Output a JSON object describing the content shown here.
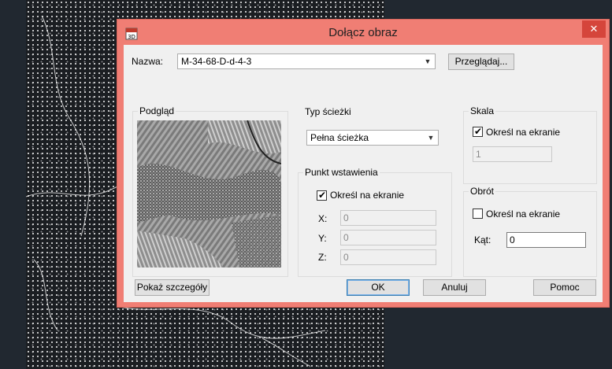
{
  "dialog": {
    "title": "Dołącz obraz",
    "close_glyph": "✕",
    "app_icon": "attach-image-app-icon"
  },
  "name_row": {
    "label": "Nazwa:",
    "value": "M-34-68-D-d-4-3",
    "browse_label": "Przeglądaj..."
  },
  "preview": {
    "caption": "Podgląd"
  },
  "path_type": {
    "caption": "Typ ścieżki",
    "value": "Pełna ścieżka"
  },
  "insertion_point": {
    "caption": "Punkt wstawienia",
    "specify_label": "Określ na ekranie",
    "specify_checked": true,
    "x_label": "X:",
    "x_value": "0",
    "y_label": "Y:",
    "y_value": "0",
    "z_label": "Z:",
    "z_value": "0"
  },
  "scale": {
    "caption": "Skala",
    "specify_label": "Określ na ekranie",
    "specify_checked": true,
    "value": "1"
  },
  "rotation": {
    "caption": "Obrót",
    "specify_label": "Określ na ekranie",
    "specify_checked": false,
    "angle_label": "Kąt:",
    "angle_value": "0"
  },
  "buttons": {
    "details": "Pokaż szczegóły",
    "ok": "OK",
    "cancel": "Anuluj",
    "help": "Pomoc"
  },
  "colors": {
    "dialog_frame": "#f07e74",
    "close_button": "#d5453b",
    "client_bg": "#f0f0f0",
    "workspace_bg": "#212830"
  }
}
